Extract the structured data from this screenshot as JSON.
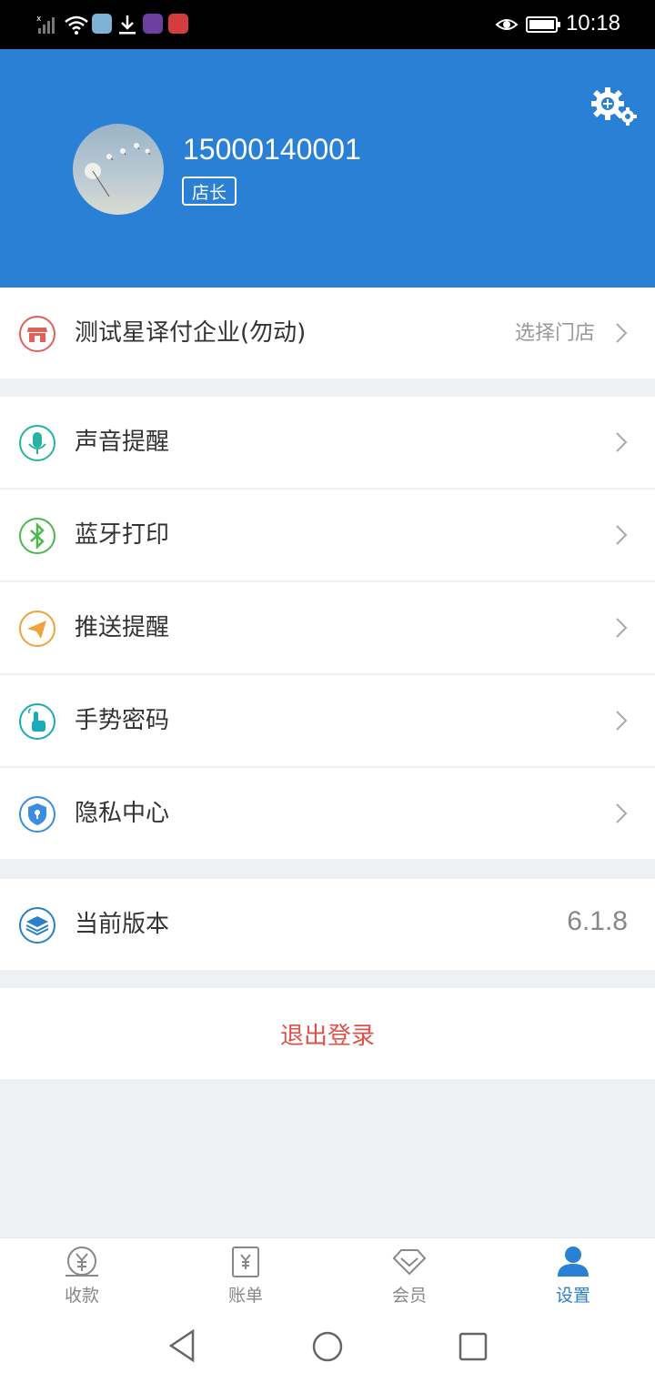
{
  "status_bar": {
    "time": "10:18"
  },
  "profile": {
    "phone": "15000140001",
    "role": "店长"
  },
  "store": {
    "name": "测试星译付企业(勿动)",
    "action": "选择门店"
  },
  "menu": [
    {
      "label": "声音提醒",
      "icon": "microphone-icon"
    },
    {
      "label": "蓝牙打印",
      "icon": "bluetooth-icon"
    },
    {
      "label": "推送提醒",
      "icon": "paper-plane-icon"
    },
    {
      "label": "手势密码",
      "icon": "hand-touch-icon"
    },
    {
      "label": "隐私中心",
      "icon": "shield-icon"
    }
  ],
  "version": {
    "label": "当前版本",
    "value": "6.1.8"
  },
  "logout": {
    "label": "退出登录"
  },
  "tabs": [
    {
      "label": "收款",
      "icon": "yen-coin-icon"
    },
    {
      "label": "账单",
      "icon": "bill-icon"
    },
    {
      "label": "会员",
      "icon": "diamond-icon"
    },
    {
      "label": "设置",
      "icon": "user-icon",
      "active": true
    }
  ],
  "colors": {
    "primary": "#2a80d4",
    "logout": "#e0504a",
    "background": "#eef1f4"
  }
}
